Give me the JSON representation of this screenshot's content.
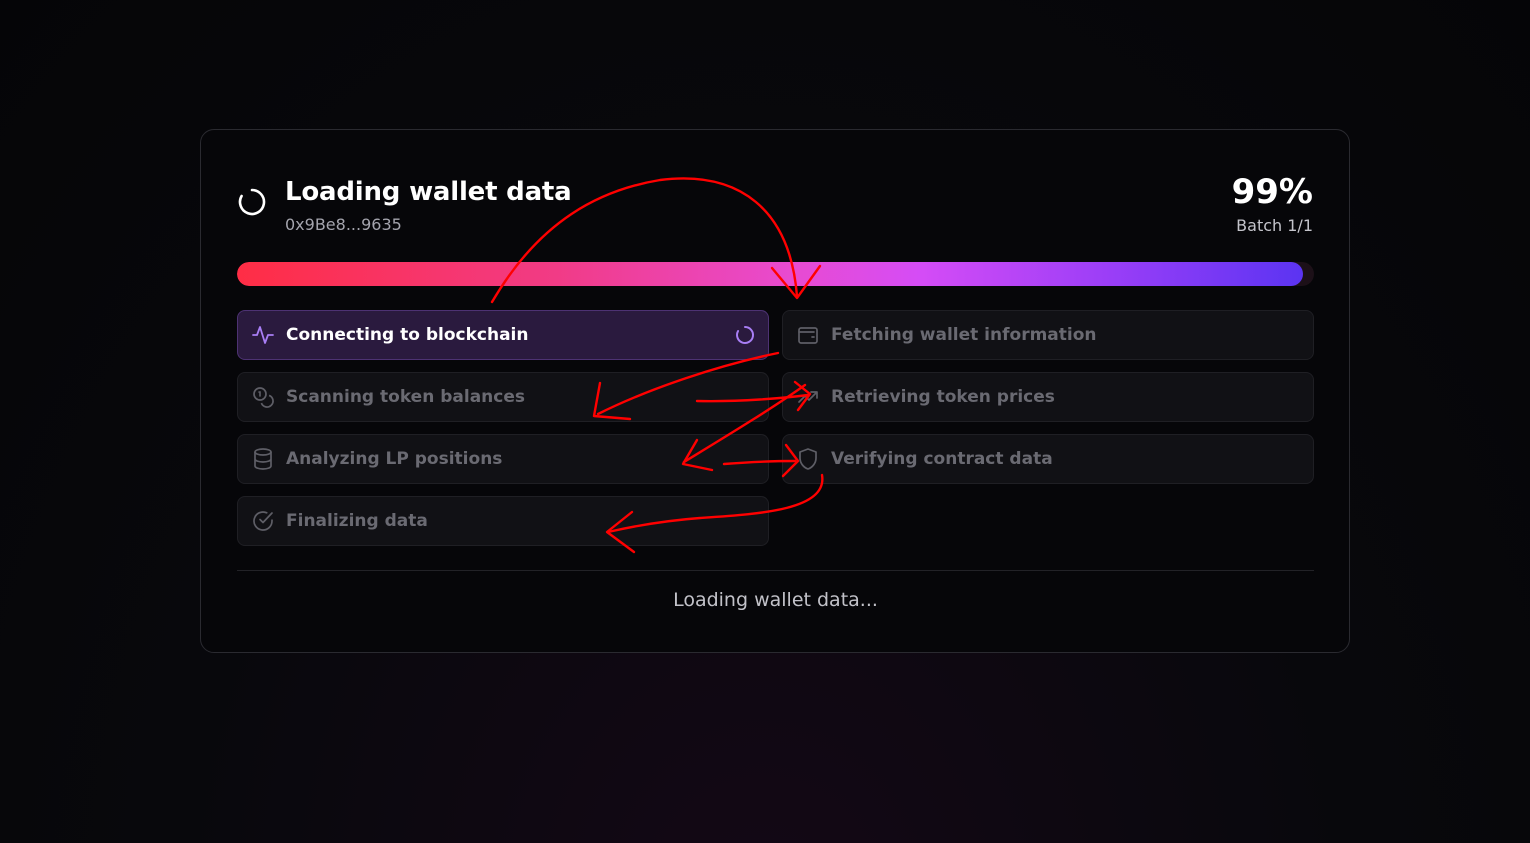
{
  "loader": {
    "title": "Loading wallet data",
    "address": "0x9Be8...9635",
    "percent_label": "99%",
    "progress": 0.99,
    "batch": "Batch 1/1",
    "status_message": "Loading wallet data..."
  },
  "steps": [
    {
      "label": "Connecting to blockchain",
      "icon": "activity-icon",
      "state": "active"
    },
    {
      "label": "Fetching wallet information",
      "icon": "wallet-icon",
      "state": "pending"
    },
    {
      "label": "Scanning token balances",
      "icon": "coins-icon",
      "state": "pending"
    },
    {
      "label": "Retrieving token prices",
      "icon": "trending-up-icon",
      "state": "pending"
    },
    {
      "label": "Analyzing LP positions",
      "icon": "database-icon",
      "state": "pending"
    },
    {
      "label": "Verifying contract data",
      "icon": "shield-icon",
      "state": "pending"
    },
    {
      "label": "Finalizing data",
      "icon": "check-circle-icon",
      "state": "pending"
    }
  ],
  "colors": {
    "accent": "#a87ef5",
    "active_bg": "#2a1a3e",
    "annotation": "#ff0000",
    "progress_start": "#ff2d45",
    "progress_end": "#5b34f2"
  }
}
